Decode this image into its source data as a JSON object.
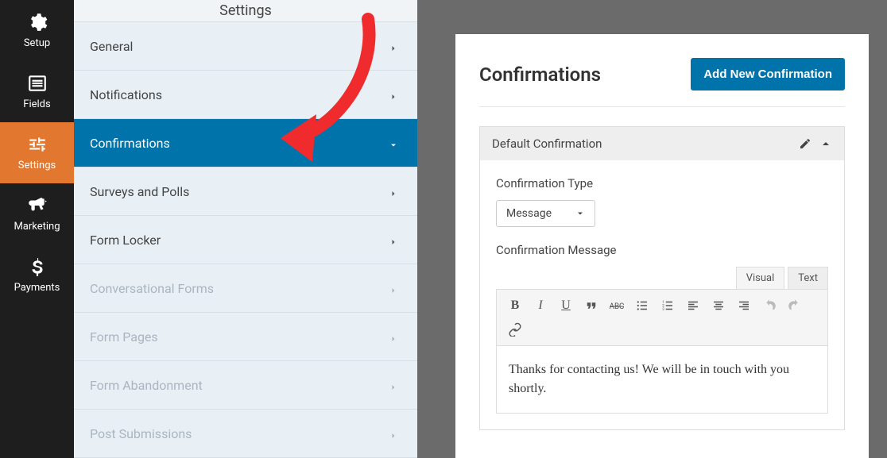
{
  "rail": {
    "items": [
      {
        "label": "Setup",
        "icon": "gear-icon"
      },
      {
        "label": "Fields",
        "icon": "fields-icon"
      },
      {
        "label": "Settings",
        "icon": "sliders-icon",
        "active": true
      },
      {
        "label": "Marketing",
        "icon": "bullhorn-icon"
      },
      {
        "label": "Payments",
        "icon": "dollar-icon"
      }
    ]
  },
  "settings": {
    "title": "Settings",
    "items": [
      {
        "label": "General"
      },
      {
        "label": "Notifications"
      },
      {
        "label": "Confirmations",
        "active": true
      },
      {
        "label": "Surveys and Polls"
      },
      {
        "label": "Form Locker"
      },
      {
        "label": "Conversational Forms",
        "disabled": true
      },
      {
        "label": "Form Pages",
        "disabled": true
      },
      {
        "label": "Form Abandonment",
        "disabled": true
      },
      {
        "label": "Post Submissions",
        "disabled": true
      }
    ]
  },
  "main": {
    "title": "Confirmations",
    "add_button_label": "Add New Confirmation",
    "box_title": "Default Confirmation",
    "type_label": "Confirmation Type",
    "type_value": "Message",
    "message_label": "Confirmation Message",
    "editor_tabs": {
      "visual": "Visual",
      "text": "Text"
    },
    "message_content": "Thanks for contacting us! We will be in touch with you shortly."
  },
  "colors": {
    "accent": "#0073aa",
    "rail_active": "#e27730",
    "arrow": "#ef2b2d"
  }
}
